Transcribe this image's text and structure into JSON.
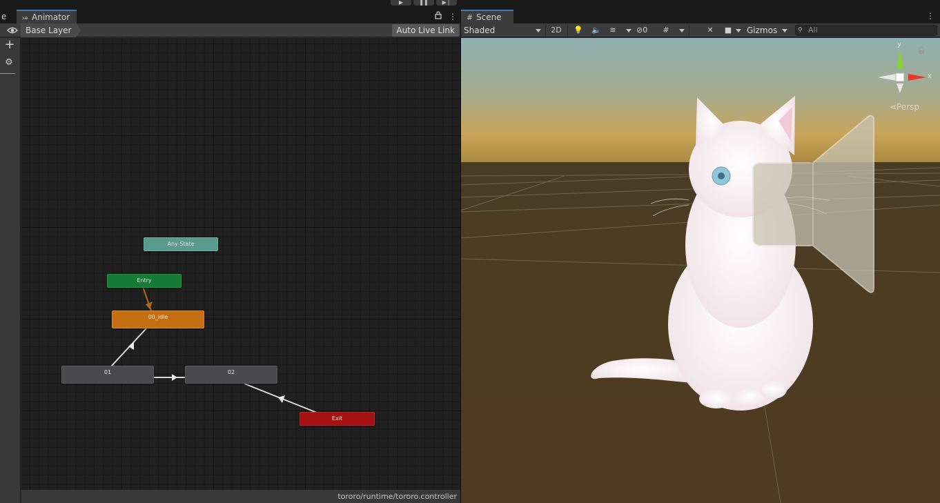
{
  "toolbar": {
    "play_icon": "play-icon",
    "pause_icon": "pause-icon",
    "step_icon": "step-icon"
  },
  "animator": {
    "prev_tab_fragment": "e",
    "tab_label": "Animator",
    "tab_icon": "animator-icon",
    "layer_breadcrumb": "Base Layer",
    "auto_live_link": "Auto Live Link",
    "nodes": {
      "any_state": "Any State",
      "entry": "Entry",
      "idle": "00_idle",
      "state_01": "01",
      "state_02": "02",
      "exit": "Exit"
    },
    "status_path": "tororo/runtime/tororo.controller"
  },
  "scene": {
    "tab_label": "Scene",
    "tab_icon": "grid-icon",
    "shading_mode": "Shaded",
    "toggle_2d": "2D",
    "hidden_count": "0",
    "gizmos_label": "Gizmos",
    "search_placeholder": "All",
    "projection_label": "Persp",
    "axis_labels": {
      "x": "x",
      "y": "y"
    }
  },
  "colors": {
    "accent_tab": "#3a79bb",
    "any_state": "#5a9a8f",
    "entry": "#157a33",
    "default_state": "#c56f14",
    "exit": "#a31111",
    "gizmo_x": "#e8392c",
    "gizmo_y": "#8ad22c"
  }
}
